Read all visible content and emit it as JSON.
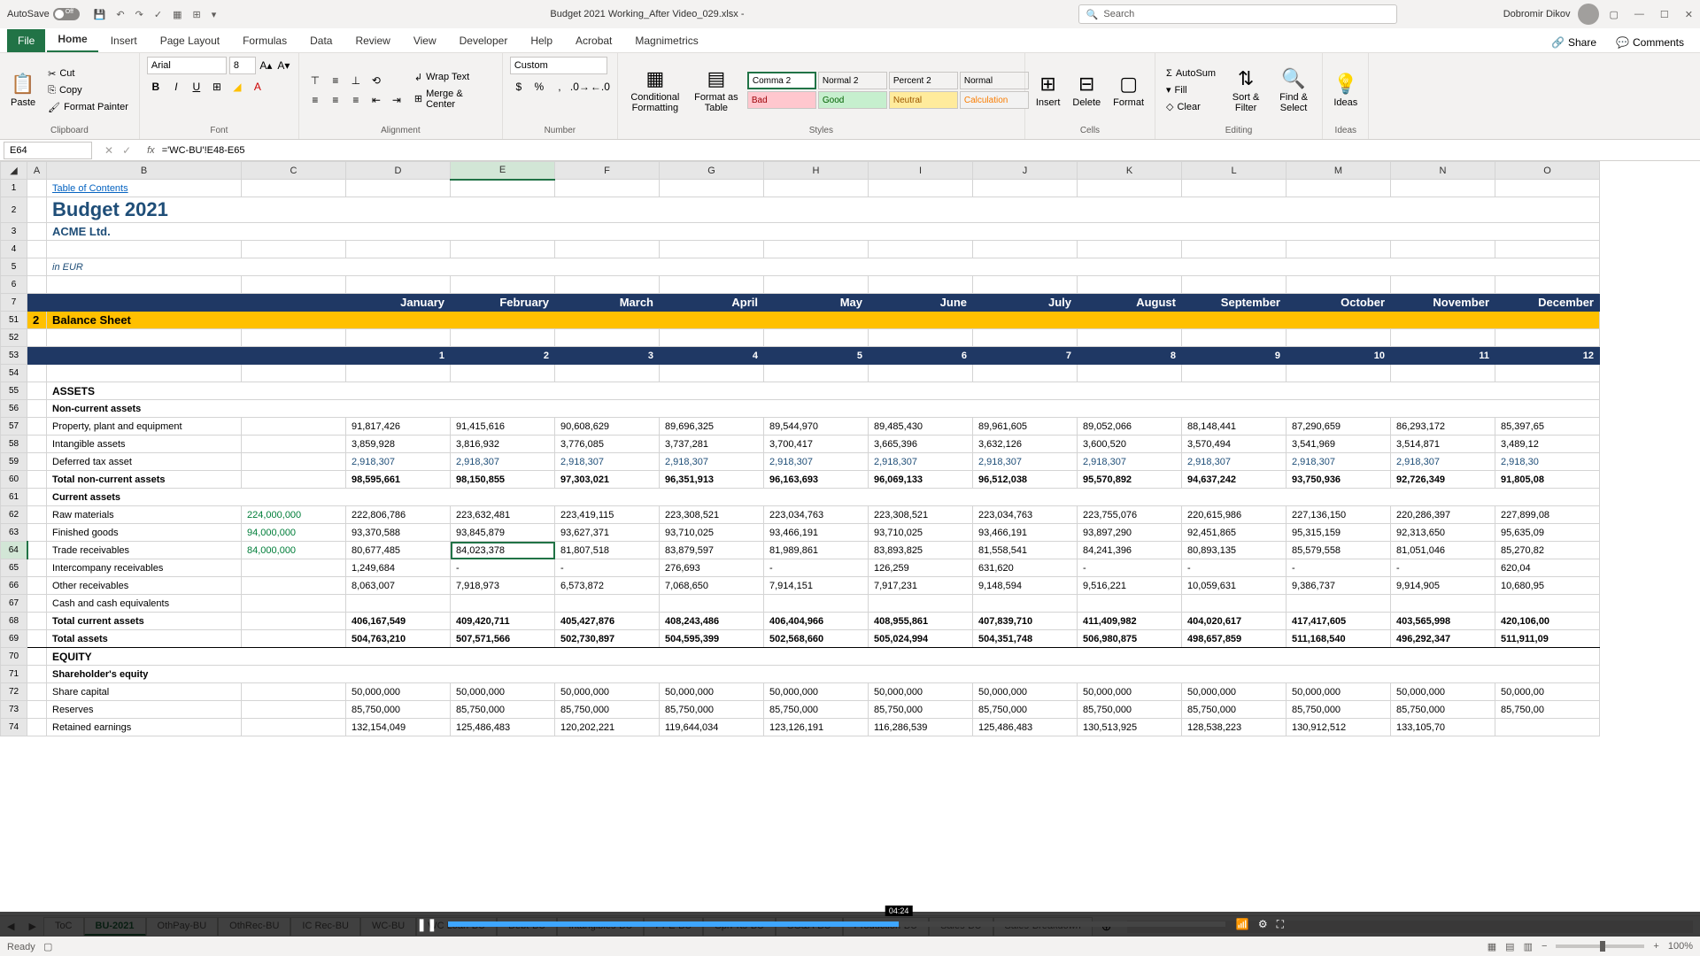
{
  "titlebar": {
    "autosave": "AutoSave",
    "autosave_state": "Off",
    "filename": "Budget 2021 Working_After Video_029.xlsx  -",
    "search_placeholder": "Search",
    "username": "Dobromir Dikov"
  },
  "tabs": {
    "file": "File",
    "home": "Home",
    "insert": "Insert",
    "pagelayout": "Page Layout",
    "formulas": "Formulas",
    "data": "Data",
    "review": "Review",
    "view": "View",
    "developer": "Developer",
    "help": "Help",
    "acrobat": "Acrobat",
    "magnimetrics": "Magnimetrics",
    "share": "Share",
    "comments": "Comments"
  },
  "ribbon": {
    "clipboard": {
      "label": "Clipboard",
      "cut": "Cut",
      "copy": "Copy",
      "painter": "Format Painter",
      "paste": "Paste"
    },
    "font": {
      "label": "Font",
      "name": "Arial",
      "size": "8"
    },
    "alignment": {
      "label": "Alignment",
      "wrap": "Wrap Text",
      "merge": "Merge & Center"
    },
    "number": {
      "label": "Number",
      "format": "Custom"
    },
    "styles": {
      "label": "Styles",
      "cond": "Conditional Formatting",
      "table": "Format as Table",
      "comma2": "Comma 2",
      "normal2": "Normal 2",
      "percent2": "Percent 2",
      "normal": "Normal",
      "bad": "Bad",
      "good": "Good",
      "neutral": "Neutral",
      "calc": "Calculation"
    },
    "cells": {
      "label": "Cells",
      "insert": "Insert",
      "delete": "Delete",
      "format": "Format"
    },
    "editing": {
      "label": "Editing",
      "autosum": "AutoSum",
      "fill": "Fill",
      "clear": "Clear",
      "sort": "Sort & Filter",
      "find": "Find & Select"
    },
    "ideas": {
      "label": "Ideas"
    }
  },
  "namebox": "E64",
  "formula": "='WC-BU'!E48-E65",
  "columns": [
    "A",
    "B",
    "C",
    "D",
    "E",
    "F",
    "G",
    "H",
    "I",
    "J",
    "K",
    "L",
    "M",
    "N",
    "O"
  ],
  "sheet": {
    "toc": "Table of Contents",
    "title": "Budget 2021",
    "company": "ACME Ltd.",
    "currency": "in EUR",
    "months": [
      "January",
      "February",
      "March",
      "April",
      "May",
      "June",
      "July",
      "August",
      "September",
      "October",
      "November",
      "December"
    ],
    "section_num": "2",
    "section_label": "Balance Sheet",
    "period_nums": [
      "1",
      "2",
      "3",
      "4",
      "5",
      "6",
      "7",
      "8",
      "9",
      "10",
      "11",
      "12"
    ],
    "assets": "ASSETS",
    "nca": "Non-current assets",
    "rows": {
      "ppe": {
        "label": "Property, plant and equipment",
        "v": [
          "91,817,426",
          "91,415,616",
          "90,608,629",
          "89,696,325",
          "89,544,970",
          "89,485,430",
          "89,961,605",
          "89,052,066",
          "88,148,441",
          "87,290,659",
          "86,293,172",
          "85,397,65"
        ]
      },
      "intang": {
        "label": "Intangible assets",
        "v": [
          "3,859,928",
          "3,816,932",
          "3,776,085",
          "3,737,281",
          "3,700,417",
          "3,665,396",
          "3,632,126",
          "3,600,520",
          "3,570,494",
          "3,541,969",
          "3,514,871",
          "3,489,12"
        ]
      },
      "dta": {
        "label": "Deferred tax asset",
        "cls": "blue-num",
        "v": [
          "2,918,307",
          "2,918,307",
          "2,918,307",
          "2,918,307",
          "2,918,307",
          "2,918,307",
          "2,918,307",
          "2,918,307",
          "2,918,307",
          "2,918,307",
          "2,918,307",
          "2,918,30"
        ]
      },
      "tnca": {
        "label": "Total non-current assets",
        "bold": true,
        "v": [
          "98,595,661",
          "98,150,855",
          "97,303,021",
          "96,351,913",
          "96,163,693",
          "96,069,133",
          "96,512,038",
          "95,570,892",
          "94,637,242",
          "93,750,936",
          "92,726,349",
          "91,805,08"
        ]
      },
      "ca": {
        "label": "Current assets",
        "bold": true
      },
      "raw": {
        "label": "Raw materials",
        "c": "224,000,000",
        "ccls": "green-num",
        "v": [
          "222,806,786",
          "223,632,481",
          "223,419,115",
          "223,308,521",
          "223,034,763",
          "223,308,521",
          "223,034,763",
          "223,755,076",
          "220,615,986",
          "227,136,150",
          "220,286,397",
          "227,899,08"
        ]
      },
      "fg": {
        "label": "Finished goods",
        "c": "94,000,000",
        "ccls": "green-num",
        "v": [
          "93,370,588",
          "93,845,879",
          "93,627,371",
          "93,710,025",
          "93,466,191",
          "93,710,025",
          "93,466,191",
          "93,897,290",
          "92,451,865",
          "95,315,159",
          "92,313,650",
          "95,635,09"
        ]
      },
      "tr": {
        "label": "Trade receivables",
        "c": "84,000,000",
        "ccls": "green-num",
        "sel": 2,
        "v": [
          "80,677,485",
          "84,023,378",
          "81,807,518",
          "83,879,597",
          "81,989,861",
          "83,893,825",
          "81,558,541",
          "84,241,396",
          "80,893,135",
          "85,579,558",
          "81,051,046",
          "85,270,82"
        ]
      },
      "ic": {
        "label": "Intercompany receivables",
        "v": [
          "1,249,684",
          "-",
          "-",
          "276,693",
          "-",
          "126,259",
          "631,620",
          "-",
          "-",
          "-",
          "-",
          "620,04"
        ]
      },
      "oth": {
        "label": "Other receivables",
        "v": [
          "8,063,007",
          "7,918,973",
          "6,573,872",
          "7,068,650",
          "7,914,151",
          "7,917,231",
          "9,148,594",
          "9,516,221",
          "10,059,631",
          "9,386,737",
          "9,914,905",
          "10,680,95"
        ]
      },
      "cash": {
        "label": "Cash and cash equivalents"
      },
      "tca": {
        "label": "Total current assets",
        "bold": true,
        "v": [
          "406,167,549",
          "409,420,711",
          "405,427,876",
          "408,243,486",
          "406,404,966",
          "408,955,861",
          "407,839,710",
          "411,409,982",
          "404,020,617",
          "417,417,605",
          "403,565,998",
          "420,106,00"
        ]
      },
      "ta": {
        "label": "Total assets",
        "grand": true,
        "v": [
          "504,763,210",
          "507,571,566",
          "502,730,897",
          "504,595,399",
          "502,568,660",
          "505,024,994",
          "504,351,748",
          "506,980,875",
          "498,657,859",
          "511,168,540",
          "496,292,347",
          "511,911,09"
        ]
      },
      "equity": {
        "label": "EQUITY",
        "bold": true
      },
      "she": {
        "label": "Shareholder's equity",
        "bold": true
      },
      "sc": {
        "label": "Share capital",
        "v": [
          "50,000,000",
          "50,000,000",
          "50,000,000",
          "50,000,000",
          "50,000,000",
          "50,000,000",
          "50,000,000",
          "50,000,000",
          "50,000,000",
          "50,000,000",
          "50,000,000",
          "50,000,00"
        ]
      },
      "res": {
        "label": "Reserves",
        "v": [
          "85,750,000",
          "85,750,000",
          "85,750,000",
          "85,750,000",
          "85,750,000",
          "85,750,000",
          "85,750,000",
          "85,750,000",
          "85,750,000",
          "85,750,000",
          "85,750,000",
          "85,750,00"
        ]
      },
      "re": {
        "label": "Retained earnings",
        "v": [
          "132,154,049",
          "125,486,483",
          "120,202,221",
          "119,644,034",
          "123,126,191",
          "116,286,539",
          "125,486,483",
          "130,513,925",
          "128,538,223",
          "130,912,512",
          "133,105,70"
        ]
      }
    }
  },
  "row_nums_visible": [
    "1",
    "2",
    "3",
    "4",
    "5",
    "6",
    "7",
    "51",
    "52",
    "53",
    "54",
    "55",
    "56",
    "57",
    "58",
    "59",
    "60",
    "61",
    "62",
    "63",
    "64",
    "65",
    "66",
    "67",
    "68",
    "69",
    "70",
    "71",
    "72",
    "73",
    "74"
  ],
  "sheet_tabs": [
    "ToC",
    "BU-2021",
    "OthPay-BU",
    "OthRec-BU",
    "IC Rec-BU",
    "WC-BU",
    "WC Loan-BU",
    "Debt-BU",
    "Intangibles-BU",
    "PPE-BU",
    "SprPrts-BU",
    "SG&A-BU",
    "Production-BU",
    "Sales-BU",
    "Sales-Breakdown"
  ],
  "active_tab": "BU-2021",
  "status": {
    "ready": "Ready",
    "zoom": "100%"
  },
  "video": {
    "time": "04:24"
  }
}
